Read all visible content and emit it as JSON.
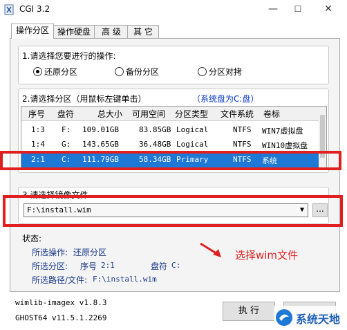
{
  "window": {
    "title": "CGI 3.2",
    "minimize": "—",
    "maximize": "☐",
    "close": "✕"
  },
  "tabs": [
    {
      "label": "操作分区"
    },
    {
      "label": "操作硬盘"
    },
    {
      "label": "高 级"
    },
    {
      "label": "其 它"
    }
  ],
  "operation": {
    "heading": "1.请选择您要进行的操作:",
    "options": [
      {
        "label": "还原分区",
        "selected": true
      },
      {
        "label": "备份分区",
        "selected": false
      },
      {
        "label": "分区对拷",
        "selected": false
      }
    ]
  },
  "partition": {
    "heading": "2.请选择分区（用鼠标左键单击）",
    "system_note": "（系统盘为C:盘）",
    "columns": [
      "序号",
      "盘符",
      "总大小",
      "可用空间",
      "分区类型",
      "文件系统",
      "卷标"
    ],
    "rows": [
      [
        "1:3",
        "F:",
        "109.01GB",
        "83.85GB",
        "Logical",
        "NTFS",
        "WIN7虚拟盘"
      ],
      [
        "1:4",
        "G:",
        "143.65GB",
        "36.48GB",
        "Logical",
        "NTFS",
        "WIN10虚拟盘"
      ],
      [
        "2:1",
        "C:",
        "111.79GB",
        "58.34GB",
        "Primary",
        "NTFS",
        "系统"
      ]
    ]
  },
  "image_file": {
    "heading": "3.请选择镜像文件",
    "value": "F:\\install.wim",
    "browse_label": "..."
  },
  "status": {
    "heading": "状态:",
    "op_label": "所选操作:",
    "op_value": "还原分区",
    "part_label": "所选分区:",
    "part_num_label": "序号",
    "part_num": "2:1",
    "drive_label": "盘符",
    "drive": "C:",
    "path_label": "所选路径/文件:",
    "path": "F:\\install.wim"
  },
  "annotation": {
    "text": "选择wim文件"
  },
  "versions": {
    "wimlib": "wimlib-imagex v1.8.3",
    "ghost": "GHOST64 v11.5.1.2269"
  },
  "buttons": {
    "execute": "执 行"
  },
  "watermark": {
    "text": "系统天地"
  },
  "colors": {
    "accent": "#1e78d6",
    "red": "#e02020",
    "status_blue": "#1a3a8a",
    "note_blue": "#0033cc"
  }
}
